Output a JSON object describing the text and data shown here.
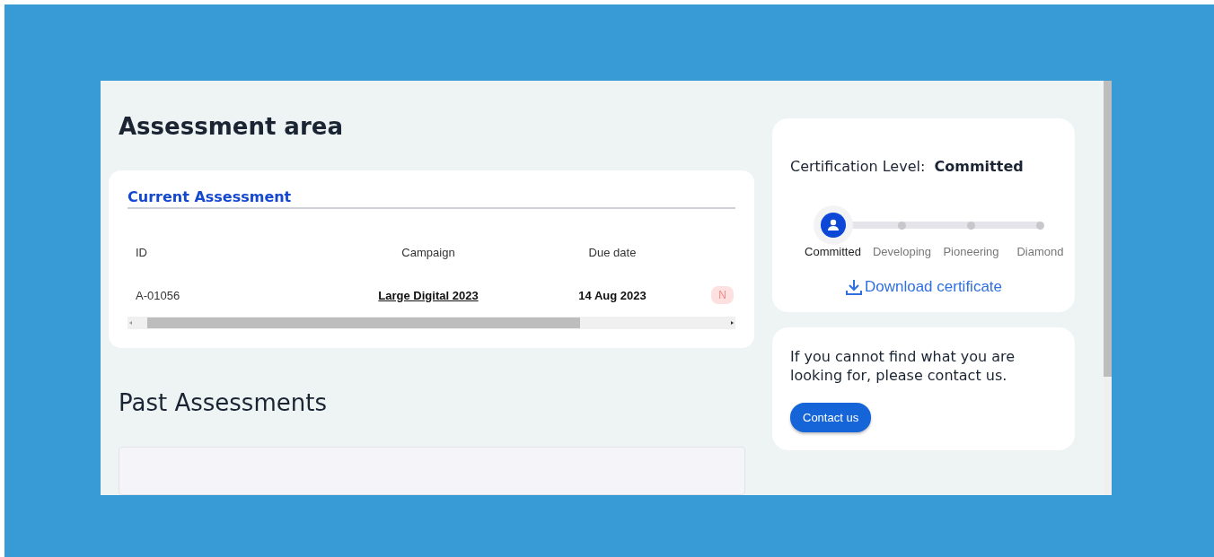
{
  "page_title": "Assessment area",
  "current_assessment": {
    "title": "Current Assessment",
    "columns": [
      "ID",
      "Campaign",
      "Due date"
    ],
    "rows": [
      {
        "id": "A-01056",
        "campaign": "Large Digital 2023",
        "due_date": "14 Aug 2023",
        "status": "N"
      }
    ]
  },
  "past_assessments": {
    "title": "Past Assessments"
  },
  "certification": {
    "label": "Certification Level:",
    "value": "Committed",
    "levels": [
      {
        "name": "Committed",
        "selected": true
      },
      {
        "name": "Developing",
        "selected": false
      },
      {
        "name": "Pioneering",
        "selected": false
      },
      {
        "name": "Diamond",
        "selected": false
      }
    ],
    "download": "Download certificate"
  },
  "contact": {
    "text": "If you cannot find what you are looking for, please contact us.",
    "button": "Contact us"
  }
}
